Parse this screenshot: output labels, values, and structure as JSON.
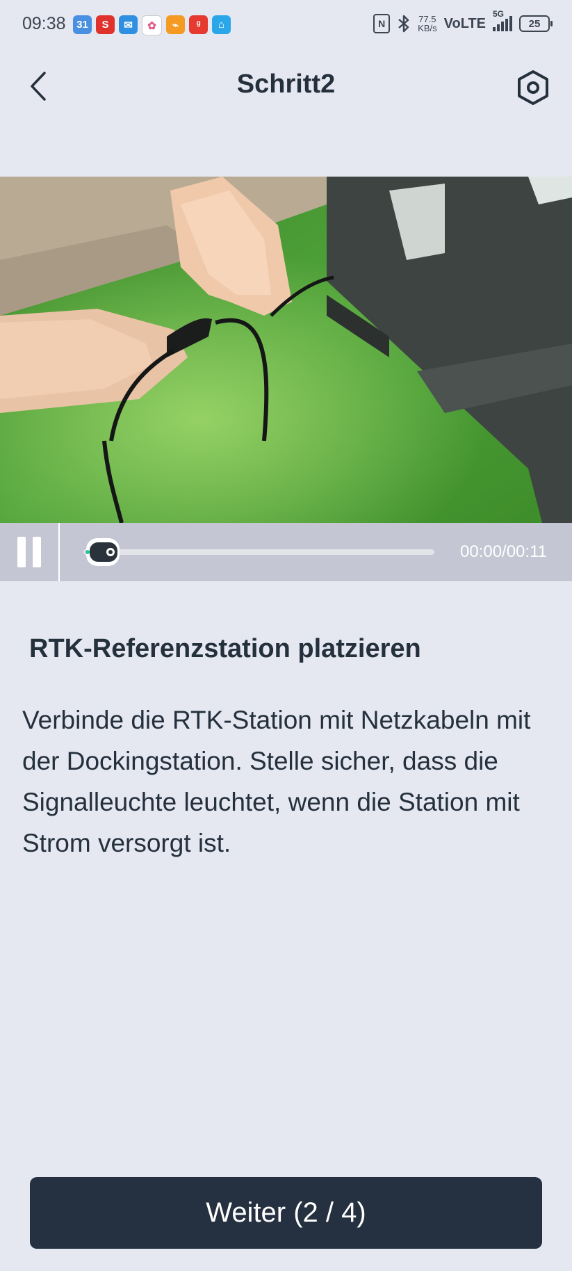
{
  "status_bar": {
    "time": "09:38",
    "app_icons": [
      {
        "name": "calendar-app-icon",
        "label": "31",
        "color": "#4a90e2"
      },
      {
        "name": "s-app-icon",
        "label": "S",
        "color": "#e0322d"
      },
      {
        "name": "mail-app-icon",
        "label": "✉",
        "color": "#2f8fe0"
      },
      {
        "name": "flower-app-icon",
        "label": "✿",
        "color": "#ffffff"
      },
      {
        "name": "link-app-icon",
        "label": "⌁",
        "color": "#f59a23"
      },
      {
        "name": "red-app-icon",
        "label": "ᵍ",
        "color": "#e6392f"
      },
      {
        "name": "home-app-icon",
        "label": "⌂",
        "color": "#2ba6e8"
      }
    ],
    "nfc": "N",
    "net_speed_value": "77.5",
    "net_speed_unit": "KB/s",
    "volte": "VoLTE",
    "network": "5G",
    "battery": "25"
  },
  "header": {
    "title": "Schritt2",
    "back_icon": "chevron-left-icon",
    "settings_icon": "hexagon-settings-icon"
  },
  "video": {
    "current_time": "00:00/00:11",
    "progress": 0.0,
    "pause_icon": "pause-icon"
  },
  "content": {
    "title": "RTK-Referenzstation platzieren",
    "description": "Verbinde die RTK-Station mit Netzkabeln mit der Dockingstation. Stelle sicher, dass die Signalleuchte leuchtet, wenn die Station mit Strom versorgt ist."
  },
  "footer": {
    "next_label": "Weiter (2 / 4)"
  }
}
